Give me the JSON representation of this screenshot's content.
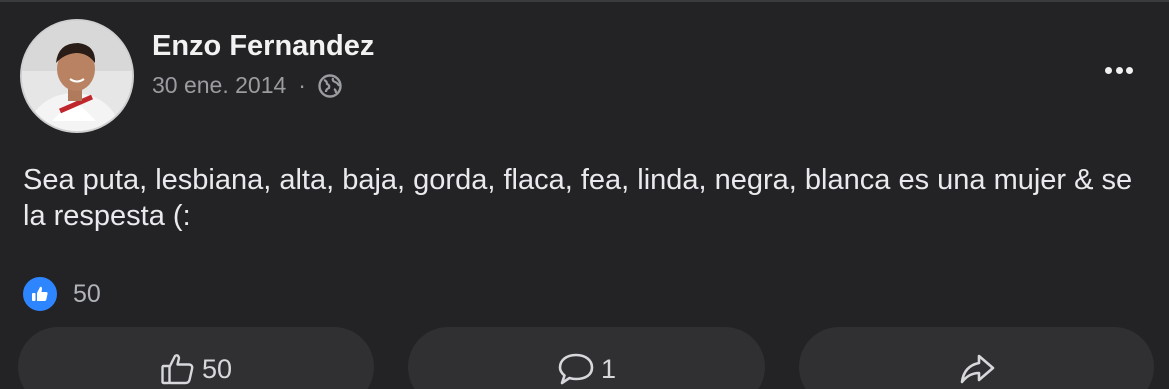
{
  "post": {
    "author": "Enzo Fernandez",
    "date": "30 ene. 2014",
    "separator": "·",
    "privacy_icon": "globe-icon",
    "more_icon": "more-options-icon",
    "text": "Sea puta, lesbiana, alta, baja, gorda, flaca, fea, linda, negra, blanca es una mujer & se la respesta (:",
    "reactions": {
      "icon": "like-reaction-icon",
      "count": "50"
    }
  },
  "actions": {
    "like": {
      "icon": "thumbs-up-icon",
      "label": "50"
    },
    "comment": {
      "icon": "comment-icon",
      "label": "1"
    },
    "share": {
      "icon": "share-icon",
      "label": ""
    }
  },
  "colors": {
    "background": "#232325",
    "like_blue": "#2d86ff",
    "button": "#303032",
    "muted_text": "#9a9ca0"
  }
}
